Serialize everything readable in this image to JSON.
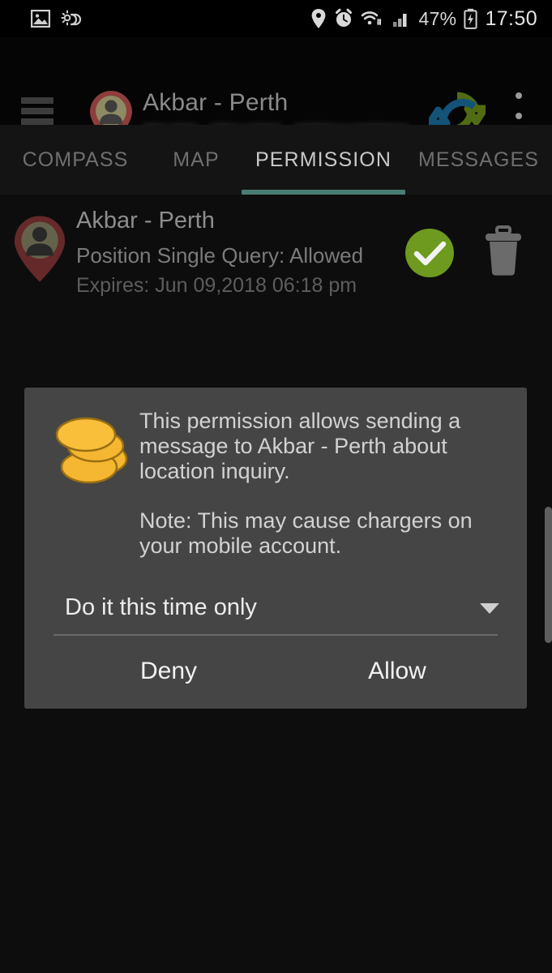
{
  "status_bar": {
    "left_icons": [
      "image-icon",
      "weather-icon"
    ],
    "right_icons": [
      "location-icon",
      "alarm-icon",
      "wifi-icon",
      "signal-icon",
      "battery-charging-icon"
    ],
    "battery_percent": "47%",
    "clock": "17:50"
  },
  "app_bar": {
    "menu_icon": "hamburger-menu-icon",
    "avatar_icon": "contact-map-pin-avatar",
    "title": "Akbar - Perth",
    "subtitle_redacted": true,
    "sync_icon": "sync-refresh-icon",
    "overflow_icon": "overflow-menu-icon"
  },
  "tabs": {
    "items": [
      {
        "label": "COMPASS",
        "active": false
      },
      {
        "label": "MAP",
        "active": false
      },
      {
        "label": "PERMISSION",
        "active": true
      },
      {
        "label": "MESSAGES",
        "active": false
      }
    ],
    "active_index": 2,
    "indicator_color": "#4a7d74"
  },
  "permission_list": {
    "rows": [
      {
        "icon": "contact-map-pin-avatar",
        "name": "Akbar - Perth",
        "status": "Position Single Query: Allowed",
        "expires": "Expires: Jun 09,2018  06:18 pm",
        "approve_icon": "green-check-circle-icon",
        "delete_icon": "trash-icon"
      }
    ]
  },
  "dialog": {
    "icon": "coins-stack-icon",
    "body_paragraph": "This permission allows sending a message to Akbar - Perth about location inquiry.",
    "note_paragraph": "Note: This may cause chargers on your mobile account.",
    "select": {
      "value": "Do it this time only",
      "caret_icon": "chevron-down-icon"
    },
    "buttons": {
      "deny": "Deny",
      "allow": "Allow"
    }
  },
  "scrollbar": {
    "visible": true
  },
  "colors": {
    "window_background": "#0d0d0d",
    "app_bar_background": "#050505",
    "dialog_background": "#454545",
    "tab_indicator": "#4a7d74",
    "approve_green": "#6d9a1f",
    "coin_gold": "#f5b731",
    "pin_red": "#9c3b3b"
  }
}
